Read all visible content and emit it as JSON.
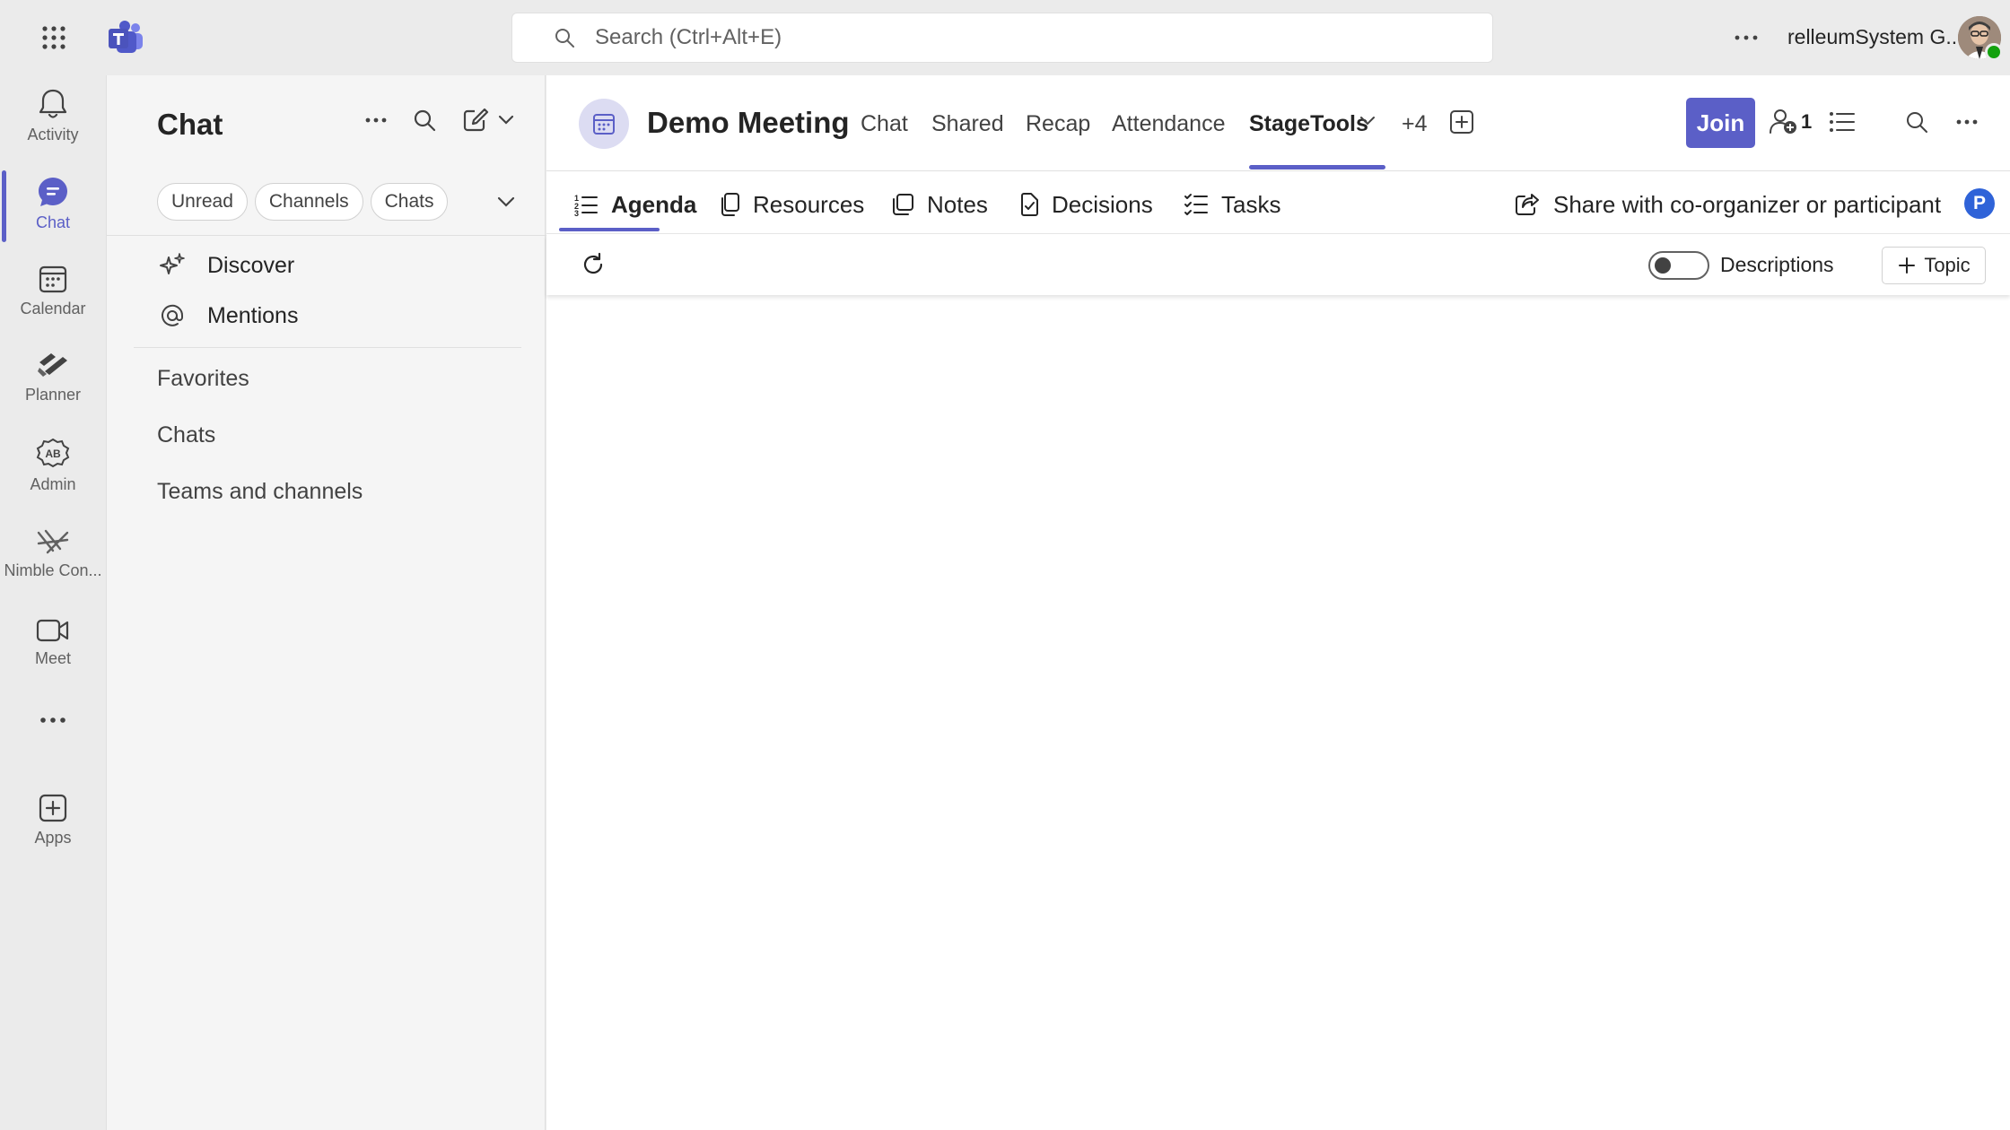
{
  "topbar": {
    "search_placeholder": "Search (Ctrl+Alt+E)",
    "user_name": "relleumSystem G..."
  },
  "rail": {
    "items": [
      {
        "label": "Activity",
        "icon": "bell-icon"
      },
      {
        "label": "Chat",
        "icon": "chat-icon",
        "active": true
      },
      {
        "label": "Calendar",
        "icon": "calendar-icon"
      },
      {
        "label": "Planner",
        "icon": "planner-icon"
      },
      {
        "label": "Admin",
        "icon": "admin-icon"
      },
      {
        "label": "Nimble Con...",
        "icon": "nimble-icon"
      },
      {
        "label": "Meet",
        "icon": "video-icon"
      },
      {
        "label": "Apps",
        "icon": "add-app-icon"
      }
    ]
  },
  "chat_pane": {
    "title": "Chat",
    "filters": [
      "Unread",
      "Channels",
      "Chats"
    ],
    "nav": [
      {
        "label": "Discover",
        "icon": "sparkle-icon"
      },
      {
        "label": "Mentions",
        "icon": "at-icon"
      }
    ],
    "sections": [
      "Favorites",
      "Chats",
      "Teams and channels"
    ]
  },
  "meeting": {
    "title": "Demo Meeting",
    "tabs": [
      "Chat",
      "Shared",
      "Recap",
      "Attendance",
      "StageTools"
    ],
    "active_tab": "StageTools",
    "more_tabs": "+4",
    "join_label": "Join",
    "participant_count": "1"
  },
  "stagetools": {
    "subtabs": [
      "Agenda",
      "Resources",
      "Notes",
      "Decisions",
      "Tasks"
    ],
    "active_subtab": "Agenda",
    "share_label": "Share with co-organizer or participant",
    "badge": "P",
    "descriptions_label": "Descriptions",
    "descriptions_on": false,
    "topic_label": "Topic"
  },
  "colors": {
    "accent": "#5b5fc7",
    "badge": "#2f63d8",
    "presence": "#13a10e"
  }
}
